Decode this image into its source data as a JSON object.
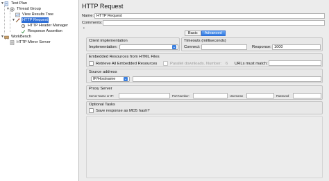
{
  "tree": {
    "items": [
      {
        "label": "Test Plan",
        "icon": "test-plan-icon"
      },
      {
        "label": "Thread Group",
        "icon": "thread-group-icon"
      },
      {
        "label": "View Results Tree",
        "icon": "listener-icon"
      },
      {
        "label": "HTTP Request",
        "icon": "sampler-icon"
      },
      {
        "label": "HTTP Header Manager",
        "icon": "config-icon"
      },
      {
        "label": "Response Assertion",
        "icon": "assertion-icon"
      },
      {
        "label": "WorkBench",
        "icon": "workbench-icon"
      },
      {
        "label": "HTTP Mirror Server",
        "icon": "server-icon"
      }
    ]
  },
  "panel": {
    "title": "HTTP Request",
    "name_label": "Name:",
    "name_value": "HTTP Request",
    "comments_label": "Comments:",
    "comments_value": ""
  },
  "tabs": [
    {
      "label": "Basic",
      "active": false
    },
    {
      "label": "Advanced",
      "active": true
    }
  ],
  "client_impl": {
    "title": "Client implementation",
    "impl_label": "Implementation:",
    "impl_value": ""
  },
  "timeouts": {
    "title": "Timeouts (milliseconds)",
    "connect_label": "Connect:",
    "connect_value": "",
    "response_label": "Response:",
    "response_value": "1000"
  },
  "embedded": {
    "title": "Embedded Resources from HTML Files",
    "retrieve_label": "Retrieve All Embedded Resources",
    "parallel_label": "Parallel downloads. Number:",
    "parallel_value": "6",
    "urls_label": "URLs must match:",
    "urls_value": ""
  },
  "source": {
    "title": "Source address",
    "type_value": "IP/Hostname",
    "address_value": ""
  },
  "proxy": {
    "title": "Proxy Server",
    "server_label": "Server Name or IP:",
    "port_label": "Port Number:",
    "username_label": "Username",
    "password_label": "Password"
  },
  "optional": {
    "title": "Optional Tasks",
    "md5_label": "Save response as MD5 hash?"
  },
  "colors": {
    "selection": "#2f6fd6",
    "background": "#ececec"
  }
}
